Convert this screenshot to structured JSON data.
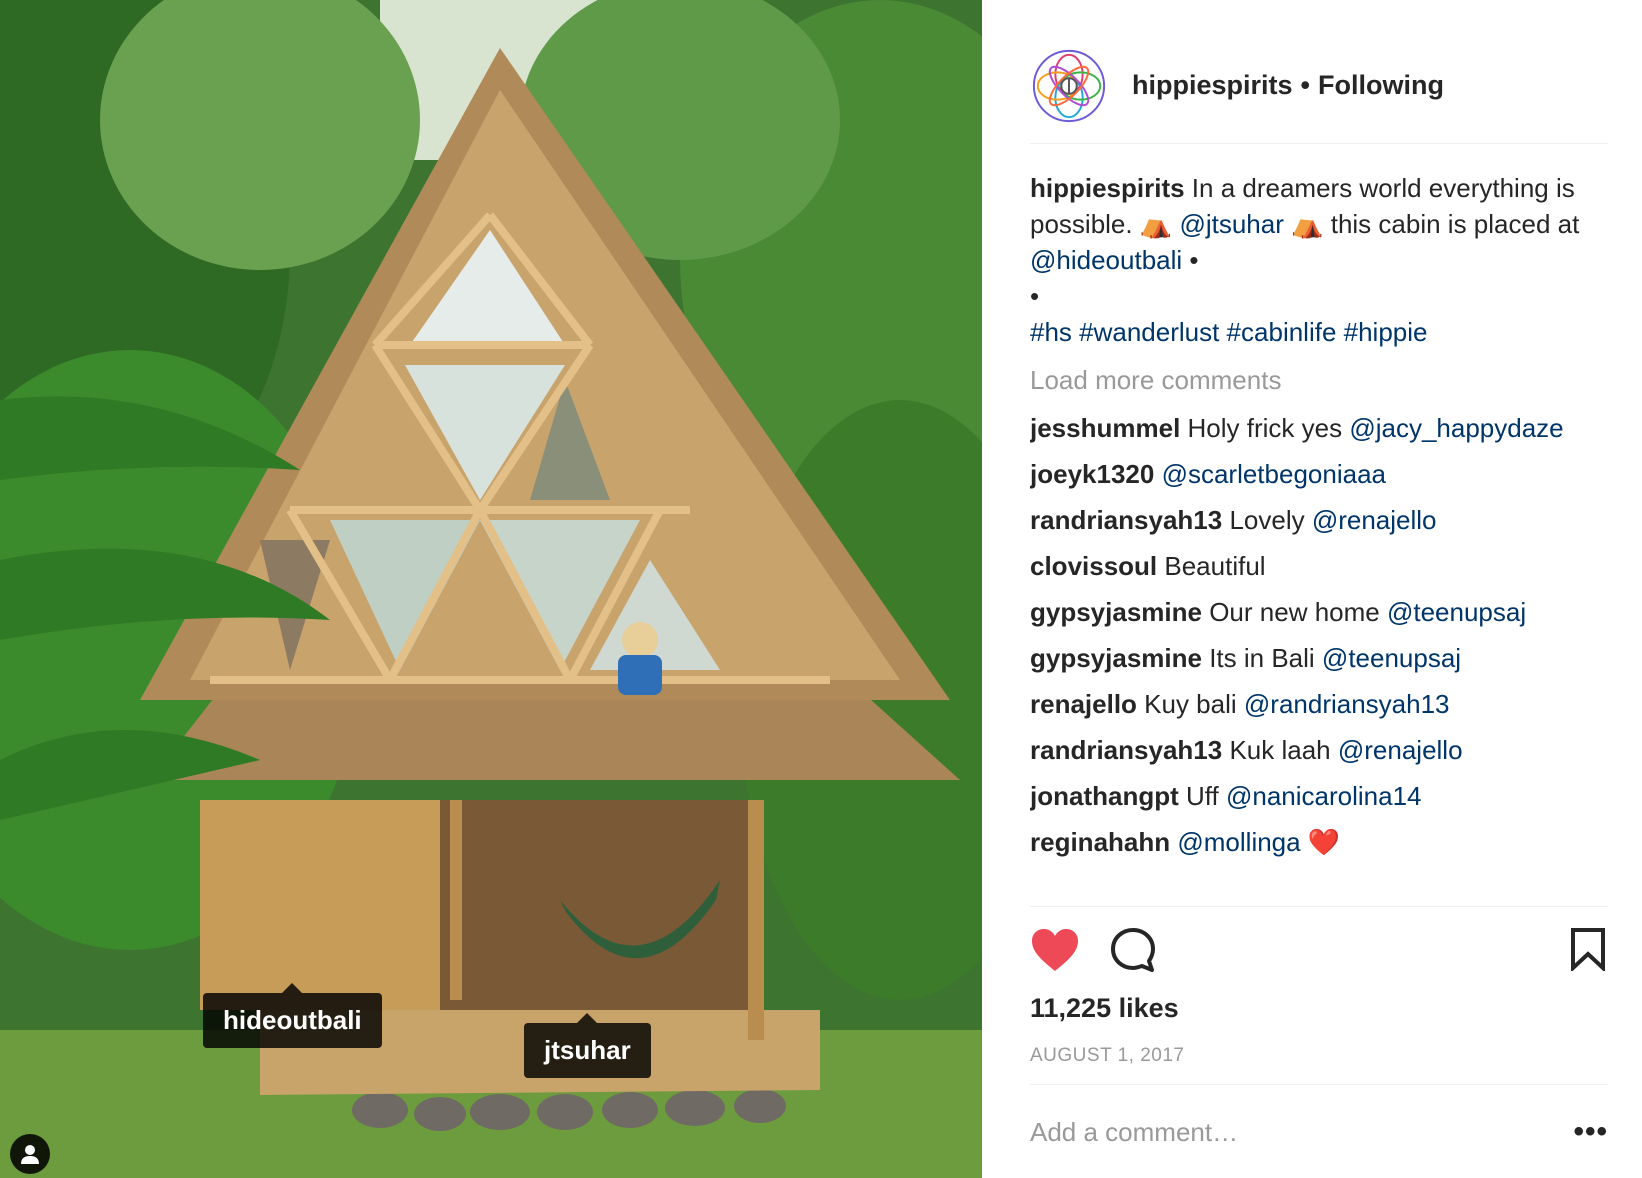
{
  "post": {
    "username": "hippiespirits",
    "follow_status": "Following",
    "separator": "•"
  },
  "photo": {
    "tags": [
      "hideoutbali",
      "jtsuhar"
    ]
  },
  "caption": {
    "username": "hippiespirits",
    "text1": " In a dreamers world everything is possible. ",
    "tent_emoji": "⛺",
    "mention1": "@jtsuhar",
    "text2": " this cabin is placed at ",
    "mention2": "@hideoutbali",
    "bullet": " •",
    "bullet2": "•",
    "hashtags": "#hs #wanderlust #cabinlife #hippie"
  },
  "load_more": "Load more comments",
  "comments": [
    {
      "user": "jesshummel",
      "text": " Holy frick yes ",
      "mention": "@jacy_happydaze"
    },
    {
      "user": "joeyk1320",
      "text": " ",
      "mention": "@scarletbegoniaaa"
    },
    {
      "user": "randriansyah13",
      "text": " Lovely ",
      "mention": "@renajello"
    },
    {
      "user": "clovissoul",
      "text": " Beautiful",
      "mention": ""
    },
    {
      "user": "gypsyjasmine",
      "text": " Our new home ",
      "mention": "@teenupsaj"
    },
    {
      "user": "gypsyjasmine",
      "text": " Its in Bali ",
      "mention": "@teenupsaj"
    },
    {
      "user": "renajello",
      "text": " Kuy bali ",
      "mention": "@randriansyah13"
    },
    {
      "user": "randriansyah13",
      "text": " Kuk laah ",
      "mention": "@renajello"
    },
    {
      "user": "jonathangpt",
      "text": " Uff ",
      "mention": "@nanicarolina14"
    },
    {
      "user": "reginahahn",
      "text": " ",
      "mention": "@mollinga ❤️"
    }
  ],
  "likes": "11,225 likes",
  "date": "AUGUST 1, 2017",
  "add_comment_placeholder": "Add a comment…",
  "more_options": "•••",
  "icons": {
    "like": "heart-icon",
    "comment": "comment-icon",
    "save": "bookmark-icon",
    "user_tags": "person-icon"
  },
  "colors": {
    "like_red": "#ed4956",
    "mention_blue": "#003569",
    "muted_gray": "#999999"
  }
}
